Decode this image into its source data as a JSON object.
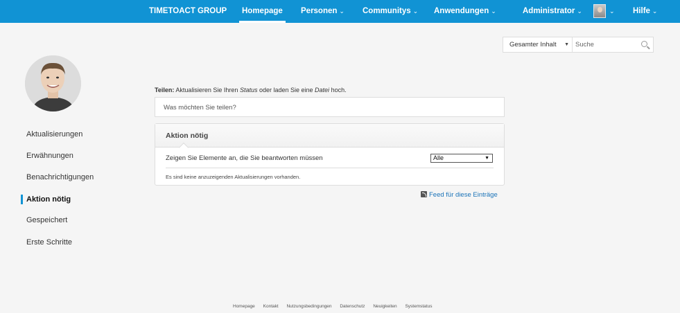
{
  "topbar": {
    "brand": "TIMETOACT GROUP",
    "nav": [
      {
        "label": "Homepage",
        "active": true,
        "dropdown": false
      },
      {
        "label": "Personen",
        "active": false,
        "dropdown": true
      },
      {
        "label": "Communitys",
        "active": false,
        "dropdown": true
      },
      {
        "label": "Anwendungen",
        "active": false,
        "dropdown": true
      }
    ],
    "user": "Administrator",
    "help": "Hilfe",
    "chevron": "⌄",
    "accent_color": "#1193d4"
  },
  "search": {
    "scope": "Gesamter Inhalt",
    "placeholder": "Suche"
  },
  "leftnav": {
    "items": [
      {
        "label": "Aktualisierungen"
      },
      {
        "label": "Erwähnungen"
      },
      {
        "label": "Benachrichtigungen"
      },
      {
        "label": "Aktion nötig"
      },
      {
        "label": "Gespeichert"
      },
      {
        "label": "Erste Schritte"
      }
    ],
    "active_index": 3
  },
  "share": {
    "label": "Teilen:",
    "text_1": "Aktualisieren Sie Ihren",
    "status": "Status",
    "text_2": "oder laden Sie eine",
    "file": "Datei",
    "text_3": "hoch.",
    "placeholder": "Was möchten Sie teilen?"
  },
  "panel": {
    "title": "Aktion nötig",
    "filter_label": "Zeigen Sie Elemente an, die Sie beantworten müssen",
    "filter_value": "Alle",
    "empty_message": "Es sind keine anzuzeigenden Aktualisierungen vorhanden."
  },
  "feed": {
    "label": "Feed für diese Einträge"
  },
  "footer": {
    "links": [
      "Homepage",
      "Kontakt",
      "Nutzungsbedingungen",
      "Datenschutz",
      "Neuigkeiten",
      "Systemstatus"
    ]
  }
}
